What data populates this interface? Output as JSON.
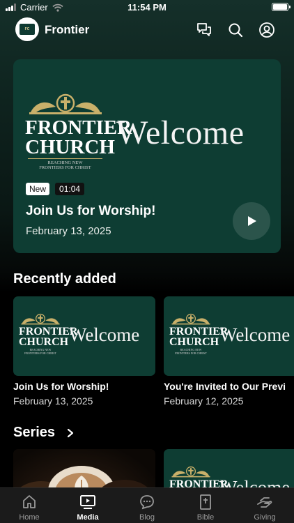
{
  "status_bar": {
    "carrier": "Carrier",
    "time": "11:54 PM"
  },
  "header": {
    "title": "Frontier",
    "icons": [
      "chat-icon",
      "search-icon",
      "profile-icon"
    ]
  },
  "logo": {
    "line1": "FRONTIER",
    "line2": "CHURCH",
    "tagline_1": "REACHING NEW",
    "tagline_2": "FRONTIERS FOR CHRIST"
  },
  "hero": {
    "image_text": "Welcome",
    "badge_new": "New",
    "duration": "01:04",
    "title": "Join Us for Worship!",
    "date": "February 13, 2025"
  },
  "recently_added": {
    "heading": "Recently added",
    "items": [
      {
        "image_text": "Welcome",
        "title": "Join Us for Worship!",
        "date": "February 13, 2025"
      },
      {
        "image_text": "Welcome",
        "title": "You're Invited to Our Previ",
        "date": "February 12, 2025"
      }
    ]
  },
  "series": {
    "heading": "Series",
    "items": [
      {
        "image_text": "Welcome"
      }
    ]
  },
  "tabbar": {
    "tabs": [
      {
        "label": "Home",
        "icon": "home-icon",
        "active": false
      },
      {
        "label": "Media",
        "icon": "media-icon",
        "active": true
      },
      {
        "label": "Blog",
        "icon": "blog-icon",
        "active": false
      },
      {
        "label": "Bible",
        "icon": "bible-icon",
        "active": false
      },
      {
        "label": "Giving",
        "icon": "giving-icon",
        "active": false
      }
    ]
  },
  "colors": {
    "card_green": "#0e3d33",
    "gold": "#c9b06a",
    "tab_bg": "#1b1b1b"
  }
}
